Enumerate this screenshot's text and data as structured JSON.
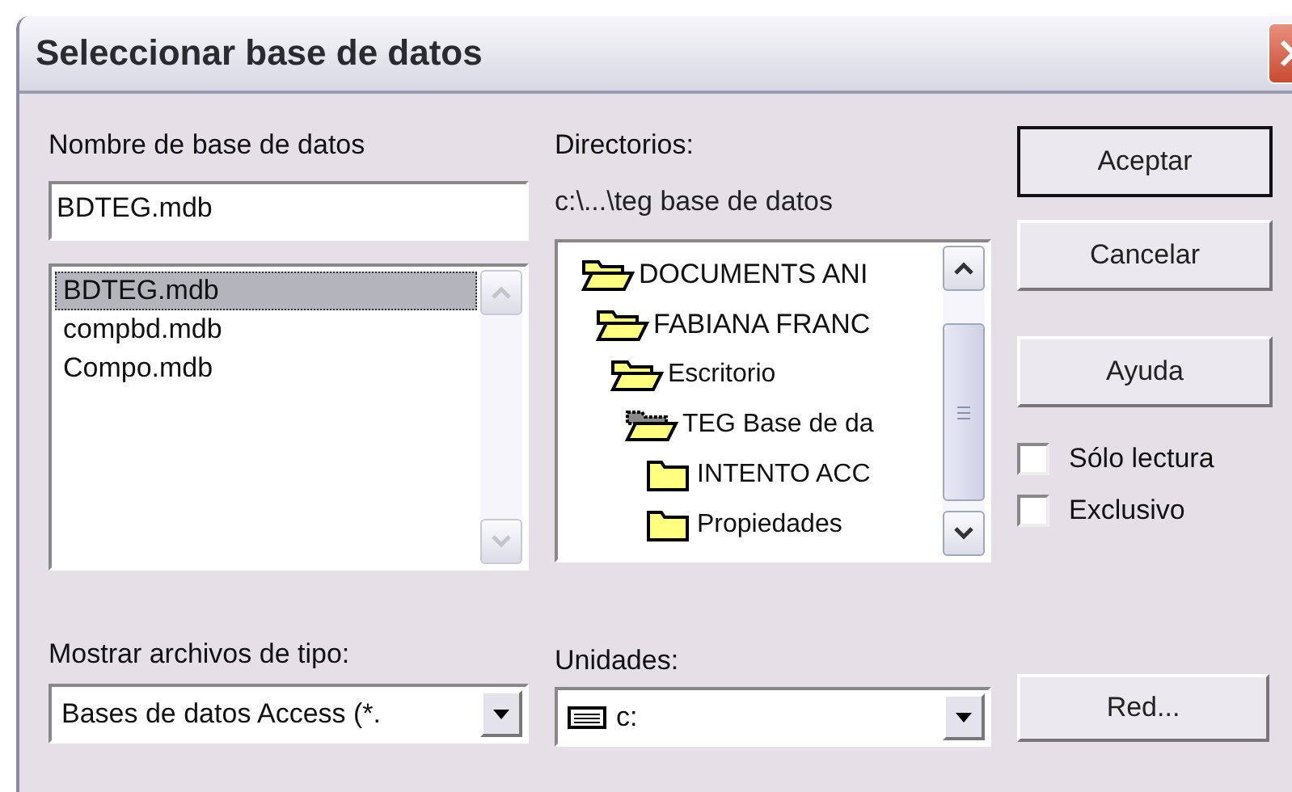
{
  "window": {
    "title": "Seleccionar base de datos"
  },
  "name_field": {
    "label": "Nombre de base de datos",
    "value": "BDTEG.mdb"
  },
  "files": [
    {
      "name": "BDTEG.mdb",
      "selected": true
    },
    {
      "name": "compbd.mdb",
      "selected": false
    },
    {
      "name": "Compo.mdb",
      "selected": false
    }
  ],
  "directories": {
    "label": "Directorios:",
    "path": "c:\\...\\teg base de datos",
    "tree": [
      {
        "name": "DOCUMENTS ANI",
        "expanded": true,
        "current": false,
        "children": [
          {
            "name": "FABIANA FRANC",
            "expanded": true,
            "current": false,
            "children": [
              {
                "name": "Escritorio",
                "expanded": true,
                "current": false,
                "children": [
                  {
                    "name": "TEG Base de da",
                    "expanded": true,
                    "current": true,
                    "children": [
                      {
                        "name": "INTENTO ACC",
                        "expanded": false,
                        "current": false
                      },
                      {
                        "name": "Propiedades",
                        "expanded": false,
                        "current": false
                      }
                    ]
                  }
                ]
              }
            ]
          }
        ]
      }
    ]
  },
  "buttons": [
    {
      "label": "Aceptar",
      "default": true
    },
    {
      "label": "Cancelar",
      "default": false
    },
    {
      "label": "Ayuda",
      "default": false
    }
  ],
  "options": [
    {
      "label": "Sólo lectura",
      "checked": false
    },
    {
      "label": "Exclusivo",
      "checked": false
    }
  ],
  "file_type": {
    "label": "Mostrar archivos de tipo:",
    "value": "Bases de datos Access (*."
  },
  "drives": {
    "label": "Unidades:",
    "value": "c:"
  },
  "network_button": {
    "label": "Red..."
  }
}
